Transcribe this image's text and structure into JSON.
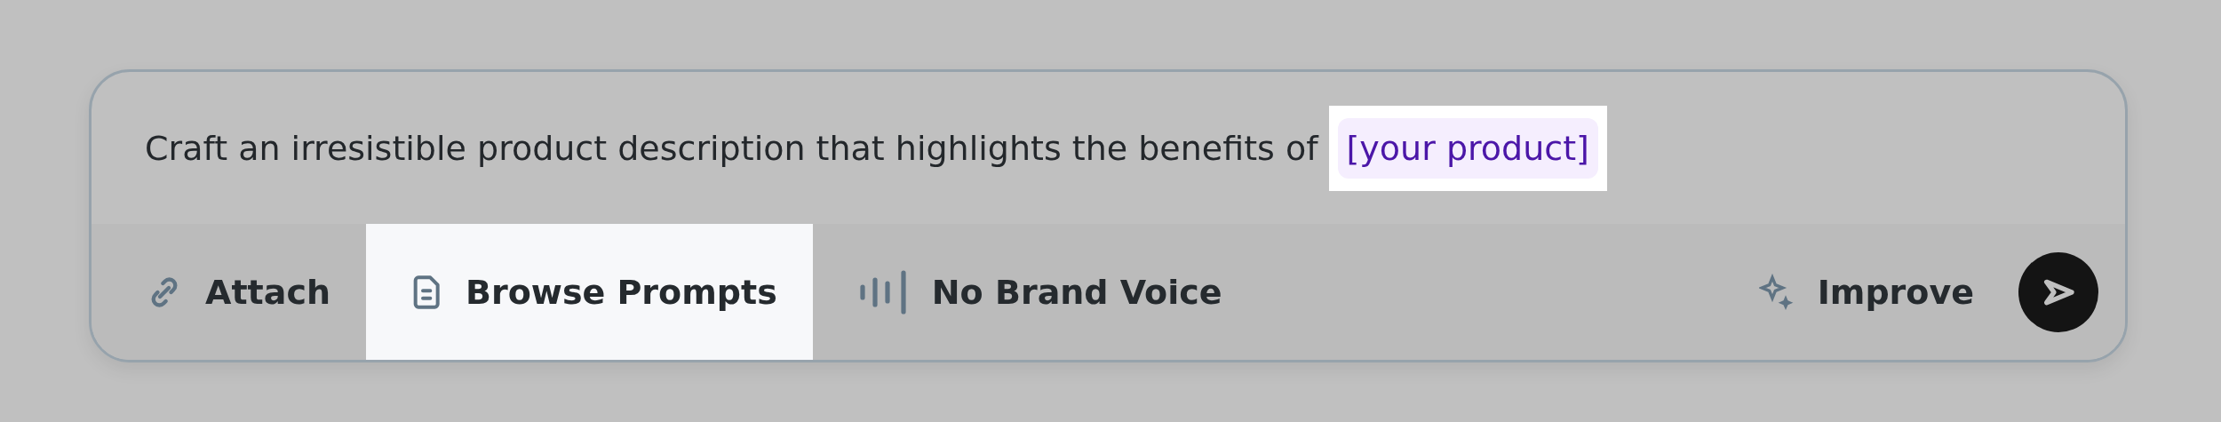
{
  "prompt": {
    "text": "Craft an irresistible product description that highlights the benefits of",
    "placeholder": {
      "text": "[your product]",
      "highlighted": true
    }
  },
  "toolbar": [
    {
      "label": "Attach",
      "highlighted": false
    },
    {
      "label": "Browse Prompts",
      "highlighted": true
    },
    {
      "label": "No Brand Voice",
      "highlighted": false
    }
  ],
  "improve": {
    "label": "Improve",
    "highlighted": false
  }
}
